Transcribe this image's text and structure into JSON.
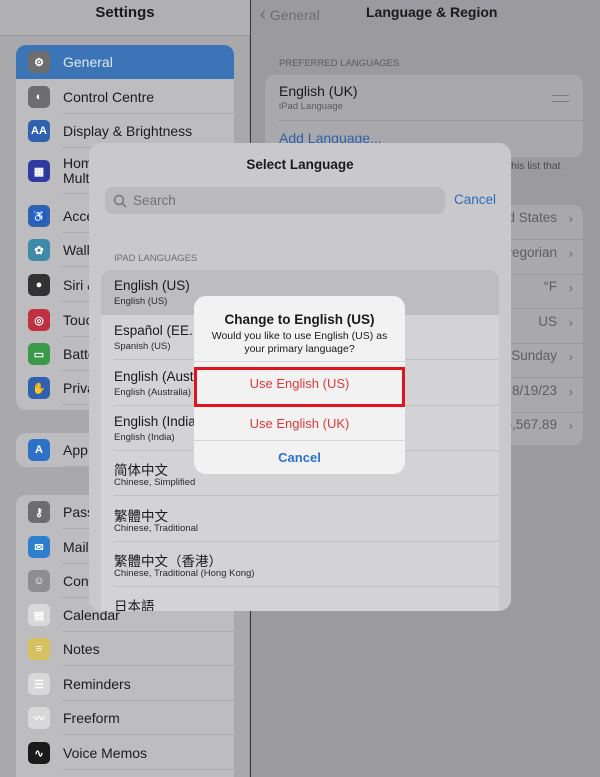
{
  "sidebar": {
    "title": "Settings",
    "accent": "#3c74b8",
    "group1": [
      {
        "label": "General",
        "icon": "gear-icon",
        "color": "#6d6d70",
        "selected": true
      },
      {
        "label": "Control Centre",
        "icon": "toggle-icon",
        "color": "#6d6d70"
      },
      {
        "label": "Display & Brightness",
        "icon": "text-size-icon",
        "color": "#2e62b0"
      },
      {
        "label": "Home Screen & Multitasking",
        "icon": "grid-icon",
        "color": "#2f3aa0"
      },
      {
        "label": "Accessibility",
        "icon": "accessibility-icon",
        "color": "#2e62b0"
      },
      {
        "label": "Wallpaper",
        "icon": "flower-icon",
        "color": "#3f8aa8"
      },
      {
        "label": "Siri & Search",
        "icon": "siri-icon",
        "color": "#333"
      },
      {
        "label": "Touch ID & Passcode",
        "icon": "fingerprint-icon",
        "color": "#c03040"
      },
      {
        "label": "Battery",
        "icon": "battery-icon",
        "color": "#3a9a48"
      },
      {
        "label": "Privacy & Security",
        "icon": "hand-icon",
        "color": "#2e62b0"
      }
    ],
    "group2": [
      {
        "label": "App Store",
        "icon": "app-store-icon",
        "color": "#2e72c8"
      }
    ],
    "group3": [
      {
        "label": "Passwords",
        "icon": "key-icon",
        "color": "#6d6d70"
      },
      {
        "label": "Mail",
        "icon": "mail-icon",
        "color": "#2e7ed0"
      },
      {
        "label": "Contacts",
        "icon": "contacts-icon",
        "color": "#8e8e90"
      },
      {
        "label": "Calendar",
        "icon": "calendar-icon",
        "color": "#d8d8d8"
      },
      {
        "label": "Notes",
        "icon": "notes-icon",
        "color": "#d6c060"
      },
      {
        "label": "Reminders",
        "icon": "reminders-icon",
        "color": "#d8d8d8"
      },
      {
        "label": "Freeform",
        "icon": "freeform-icon",
        "color": "#d8d8d8"
      },
      {
        "label": "Voice Memos",
        "icon": "waveform-icon",
        "color": "#1a1a1a"
      }
    ]
  },
  "main": {
    "back_label": "General",
    "title": "Language & Region",
    "preferred_label": "PREFERRED LANGUAGES",
    "preferred": {
      "name": "English (UK)",
      "sub": "iPad Language"
    },
    "add_language": "Add Language...",
    "footer_fragment": "his list that",
    "region_values": [
      "d States",
      "regorian",
      "°F",
      "US",
      "Sunday",
      "8/19/23",
      "5,567.89"
    ]
  },
  "sheet": {
    "title": "Select Language",
    "search_placeholder": "Search",
    "cancel": "Cancel",
    "section": "IPAD LANGUAGES",
    "languages": [
      {
        "name": "English (US)",
        "sub": "English (US)"
      },
      {
        "name": "Español (EE. UU.)",
        "sub": "Spanish (US)"
      },
      {
        "name": "English (Australia)",
        "sub": "English (Australia)"
      },
      {
        "name": "English (India)",
        "sub": "English (India)"
      },
      {
        "name": "简体中文",
        "sub": "Chinese, Simplified"
      },
      {
        "name": "繁體中文",
        "sub": "Chinese, Traditional"
      },
      {
        "name": "繁體中文（香港）",
        "sub": "Chinese, Traditional (Hong Kong)"
      },
      {
        "name": "日本語",
        "sub": ""
      }
    ]
  },
  "alert": {
    "title": "Change to English (US)",
    "message": "Would you like to use English (US) as your primary language?",
    "use_us": "Use English (US)",
    "use_uk": "Use English (UK)",
    "cancel": "Cancel",
    "destructive_color": "#e5383b",
    "highlight_color": "#e0141e"
  }
}
